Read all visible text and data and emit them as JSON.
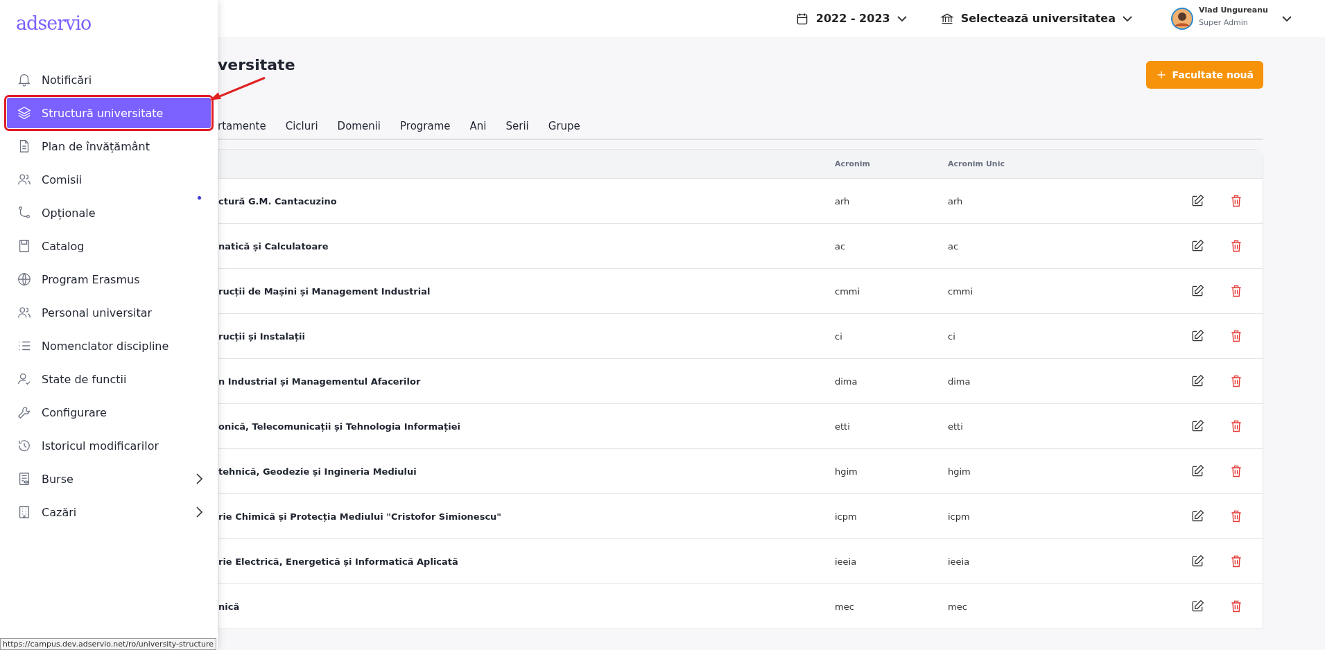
{
  "logo": "adservio",
  "sidebar": {
    "items": [
      {
        "label": "Notificări",
        "selected": false,
        "expandable": false,
        "annotated": false
      },
      {
        "label": "Structură universitate",
        "selected": true,
        "expandable": false,
        "annotated": true
      },
      {
        "label": "Plan de învățământ",
        "selected": false,
        "expandable": false,
        "annotated": false
      },
      {
        "label": "Comisii",
        "selected": false,
        "expandable": false,
        "annotated": false
      },
      {
        "label": "Opționale",
        "selected": false,
        "expandable": false,
        "annotated": false
      },
      {
        "label": "Catalog",
        "selected": false,
        "expandable": false,
        "annotated": false
      },
      {
        "label": "Program Erasmus",
        "selected": false,
        "expandable": false,
        "annotated": false
      },
      {
        "label": "Personal universitar",
        "selected": false,
        "expandable": false,
        "annotated": false
      },
      {
        "label": "Nomenclator discipline",
        "selected": false,
        "expandable": false,
        "annotated": false
      },
      {
        "label": "State de functii",
        "selected": false,
        "expandable": false,
        "annotated": false
      },
      {
        "label": "Configurare",
        "selected": false,
        "expandable": false,
        "annotated": false
      },
      {
        "label": "Istoricul modificarilor",
        "selected": false,
        "expandable": false,
        "annotated": false
      },
      {
        "label": "Burse",
        "selected": false,
        "expandable": true,
        "annotated": false
      },
      {
        "label": "Cazări",
        "selected": false,
        "expandable": true,
        "annotated": false
      }
    ]
  },
  "status_url": "https://campus.dev.adservio.net/ro/university-structure",
  "header": {
    "year": "2022 - 2023",
    "university": "Selectează universitatea",
    "user_name": "Vlad Ungureanu",
    "user_role": "Super Admin"
  },
  "page_title": "versitate",
  "new_button": "Facultate nouă",
  "tabs": [
    {
      "label": "rtamente",
      "selected": false
    },
    {
      "label": "Cicluri",
      "selected": false
    },
    {
      "label": "Domenii",
      "selected": false
    },
    {
      "label": "Programe",
      "selected": false
    },
    {
      "label": "Ani",
      "selected": false
    },
    {
      "label": "Serii",
      "selected": false
    },
    {
      "label": "Grupe",
      "selected": false
    }
  ],
  "table": {
    "columns": [
      "Acronim",
      "Acronim Unic"
    ],
    "rows": [
      {
        "name": "ctură G.M. Cantacuzino",
        "acronym": "arh",
        "unique_acronym": "arh"
      },
      {
        "name": "natică și Calculatoare",
        "acronym": "ac",
        "unique_acronym": "ac"
      },
      {
        "name": "rucții de Mașini și Management Industrial",
        "acronym": "cmmi",
        "unique_acronym": "cmmi"
      },
      {
        "name": "rucții și Instalații",
        "acronym": "ci",
        "unique_acronym": "ci"
      },
      {
        "name": "n Industrial și Managementul Afacerilor",
        "acronym": "dima",
        "unique_acronym": "dima"
      },
      {
        "name": "onică, Telecomunicații și Tehnologia Informației",
        "acronym": "etti",
        "unique_acronym": "etti"
      },
      {
        "name": "tehnică, Geodezie și Ingineria Mediului",
        "acronym": "hgim",
        "unique_acronym": "hgim"
      },
      {
        "name": "rie Chimică și Protecția Mediului \"Cristofor Simionescu\"",
        "acronym": "icpm",
        "unique_acronym": "icpm"
      },
      {
        "name": "rie Electrică, Energetică și Informatică Aplicată",
        "acronym": "ieeia",
        "unique_acronym": "ieeia"
      },
      {
        "name": "nică",
        "acronym": "mec",
        "unique_acronym": "mec"
      }
    ]
  }
}
